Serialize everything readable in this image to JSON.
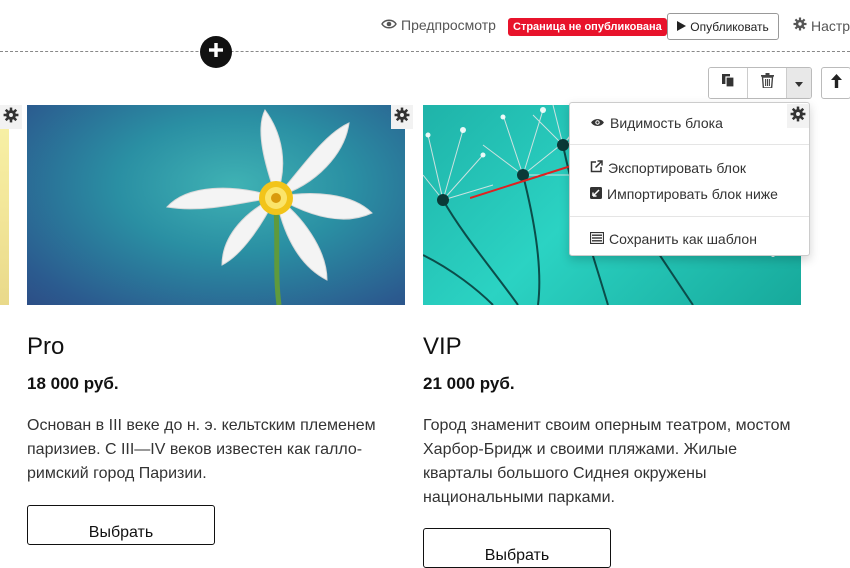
{
  "toolbar": {
    "preview_label": "Предпросмотр",
    "unpublished_badge": "Страница не опубликована",
    "publish_label": "Опубликовать",
    "settings_label": "Настр"
  },
  "icons": {
    "preview": "eye-icon",
    "publish": "play-icon",
    "settings": "gear-icon",
    "add_block": "plus-circle-icon",
    "copy": "copy-icon",
    "delete": "trash-icon",
    "more": "caret-down-icon",
    "move_up": "arrow-up-icon"
  },
  "colors": {
    "badge": "#e8132b",
    "arrow": "#e02020",
    "accent_dark": "#111111"
  },
  "block_menu": {
    "items": [
      {
        "label": "Видимость блока",
        "icon": "eye-icon"
      },
      {
        "label": "Экспортировать блок",
        "icon": "external-link-icon"
      },
      {
        "label": "Импортировать блок ниже",
        "icon": "import-icon"
      },
      {
        "label": "Сохранить как шаблон",
        "icon": "template-icon"
      }
    ]
  },
  "plans": [
    {
      "title": "Pro",
      "price": "18 000 руб.",
      "description": "Основан в III веке до н. э. кельтским племенем паризиев. С III—IV веков известен как галло-римский город Паризии.",
      "button": "Выбрать",
      "image": "white-flower"
    },
    {
      "title": "VIP",
      "price": "21 000 руб.",
      "description": "Город знаменит своим оперным театром, мостом Харбор-Бридж и своими пляжами. Жилые кварталы большого Сиднея окружены национальными парками.",
      "button": "Выбрать",
      "image": "dandelion-dew"
    }
  ]
}
